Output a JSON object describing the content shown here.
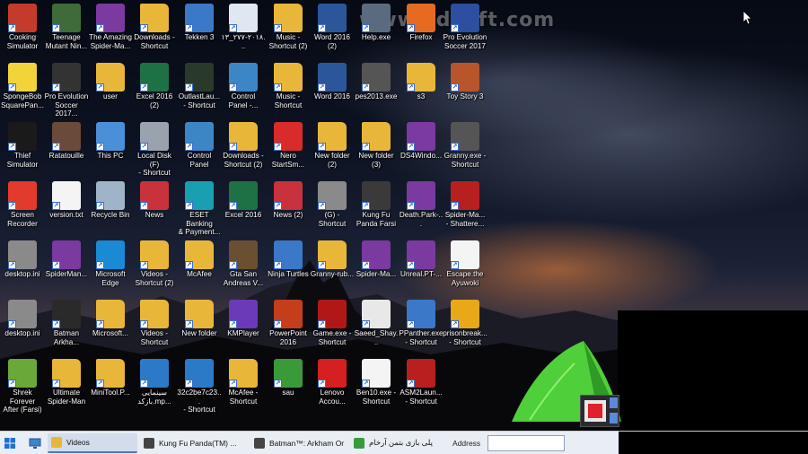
{
  "desktop": {
    "watermark": "www.zdsoft.com",
    "icons": [
      {
        "label": "Cooking\nSimulator",
        "icon": "cooking-game-icon",
        "color": "#c43b2b"
      },
      {
        "label": "Teenage\nMutant Nin...",
        "icon": "turtles-game-icon",
        "color": "#3f6b3a"
      },
      {
        "label": "The Amazing\nSpider-Ma...",
        "icon": "winrar-icon",
        "color": "#7a3aa0"
      },
      {
        "label": "Downloads -\nShortcut",
        "icon": "folder-download-icon",
        "color": "#e8b73a"
      },
      {
        "label": "Tekken 3",
        "icon": "window-icon",
        "color": "#3c78c8"
      },
      {
        "label": "٢٠١٨-٢٧٧_١٣...",
        "icon": "image-file-icon",
        "color": "#dfe7f2"
      },
      {
        "label": "Music -\nShortcut (2)",
        "icon": "folder-music-icon",
        "color": "#e8b73a"
      },
      {
        "label": "Word 2016\n(2)",
        "icon": "word-icon",
        "color": "#2b579a"
      },
      {
        "label": "Help.exe",
        "icon": "window-icon",
        "color": "#5a6b80"
      },
      {
        "label": "Firefox",
        "icon": "firefox-icon",
        "color": "#e66a1f"
      },
      {
        "label": "Pro Evolution\nSoccer 2017",
        "icon": "pes-icon",
        "color": "#2c4fa0"
      },
      {
        "label": "SpongeBob\nSquarePan...",
        "icon": "spongebob-icon",
        "color": "#f2d43a"
      },
      {
        "label": "Pro Evolution\nSoccer 2017...",
        "icon": "pes-icon",
        "color": "#333333"
      },
      {
        "label": "user",
        "icon": "folder-user-icon",
        "color": "#e8b73a"
      },
      {
        "label": "Excel 2016 (2)",
        "icon": "excel-icon",
        "color": "#1e7145"
      },
      {
        "label": "OutlastLau...\n- Shortcut",
        "icon": "outlast-icon",
        "color": "#2a3a2a"
      },
      {
        "label": "Control\nPanel -...",
        "icon": "control-panel-icon",
        "color": "#3d86c6"
      },
      {
        "label": "Music -\nShortcut",
        "icon": "folder-music-icon",
        "color": "#e8b73a"
      },
      {
        "label": "Word 2016",
        "icon": "word-icon",
        "color": "#2b579a"
      },
      {
        "label": "pes2013.exe",
        "icon": "pes-icon",
        "color": "#555555"
      },
      {
        "label": "s3",
        "icon": "folder-icon",
        "color": "#e8b73a"
      },
      {
        "label": "Toy Story 3",
        "icon": "toy-story-icon",
        "color": "#b9552b"
      },
      {
        "label": "Thief\nSimulator",
        "icon": "thief-icon",
        "color": "#1a1a1a"
      },
      {
        "label": "Ratatouille",
        "icon": "ratatouille-icon",
        "color": "#6a4a3a"
      },
      {
        "label": "This PC",
        "icon": "pc-icon",
        "color": "#4a90d8"
      },
      {
        "label": "Local Disk (F)\n- Shortcut",
        "icon": "disk-icon",
        "color": "#9aa3ad"
      },
      {
        "label": "Control\nPanel",
        "icon": "control-panel-icon",
        "color": "#3d86c6"
      },
      {
        "label": "Downloads -\nShortcut (2)",
        "icon": "folder-download-icon",
        "color": "#e8b73a"
      },
      {
        "label": "Nero\nStartSm...",
        "icon": "nero-icon",
        "color": "#d92b2b"
      },
      {
        "label": "New folder\n(2)",
        "icon": "folder-icon",
        "color": "#e8b73a"
      },
      {
        "label": "New folder\n(3)",
        "icon": "folder-icon",
        "color": "#e8b73a"
      },
      {
        "label": "DS4Windo...",
        "icon": "winrar-icon",
        "color": "#7a3aa0"
      },
      {
        "label": "Granny.exe -\nShortcut",
        "icon": "granny-icon",
        "color": "#555555"
      },
      {
        "label": "Screen\nRecorder",
        "icon": "record-icon",
        "color": "#e23b2b"
      },
      {
        "label": "version.txt",
        "icon": "text-file-icon",
        "color": "#f4f4f4"
      },
      {
        "label": "Recycle Bin",
        "icon": "recycle-bin-icon",
        "color": "#9fb4c8"
      },
      {
        "label": "News",
        "icon": "news-icon",
        "color": "#c8323c"
      },
      {
        "label": "ESET Banking\n& Payment...",
        "icon": "eset-icon",
        "color": "#1a9fb0"
      },
      {
        "label": "Excel 2016",
        "icon": "excel-icon",
        "color": "#1e7145"
      },
      {
        "label": "News (2)",
        "icon": "news-icon",
        "color": "#c8323c"
      },
      {
        "label": "(G) -\nShortcut",
        "icon": "dvd-drive-icon",
        "color": "#8a8a8a"
      },
      {
        "label": "Kung Fu\nPanda Farsi",
        "icon": "panda-icon",
        "color": "#3a3a3a"
      },
      {
        "label": "Death.Park-...",
        "icon": "winrar-icon",
        "color": "#7a3aa0"
      },
      {
        "label": "Spider-Ma...\n- Shattere...",
        "icon": "spiderman-icon",
        "color": "#b82020"
      },
      {
        "label": "desktop.ini",
        "icon": "settings-file-icon",
        "color": "#8a8a8a"
      },
      {
        "label": "SpiderMan...",
        "icon": "winrar-icon",
        "color": "#7a3aa0"
      },
      {
        "label": "Microsoft\nEdge",
        "icon": "edge-icon",
        "color": "#1a8ad4"
      },
      {
        "label": "Videos -\nShortcut (2)",
        "icon": "folder-video-icon",
        "color": "#e8b73a"
      },
      {
        "label": "McAfee",
        "icon": "folder-icon",
        "color": "#e8b73a"
      },
      {
        "label": "Gta San\nAndreas V...",
        "icon": "gta-icon",
        "color": "#6a5030"
      },
      {
        "label": "Ninja Turtles",
        "icon": "window-icon",
        "color": "#3c78c8"
      },
      {
        "label": "Granny-rub...",
        "icon": "folder-icon",
        "color": "#e8b73a"
      },
      {
        "label": "Spider-Ma...",
        "icon": "winrar-icon",
        "color": "#7a3aa0"
      },
      {
        "label": "Unreal.PT-...",
        "icon": "winrar-icon",
        "color": "#7a3aa0"
      },
      {
        "label": "Escape.the\nAyuwoki",
        "icon": "blank-file-icon",
        "color": "#f4f4f4"
      },
      {
        "label": "desktop.ini",
        "icon": "settings-file-icon",
        "color": "#8a8a8a"
      },
      {
        "label": "Batman\nArkha...",
        "icon": "batman-icon",
        "color": "#2a2a2a"
      },
      {
        "label": "Microsoft...",
        "icon": "folder-icon",
        "color": "#e8b73a"
      },
      {
        "label": "Videos -\nShortcut",
        "icon": "folder-video-icon",
        "color": "#e8b73a"
      },
      {
        "label": "New folder",
        "icon": "folder-icon",
        "color": "#e8b73a"
      },
      {
        "label": "KMPlayer",
        "icon": "kmplayer-icon",
        "color": "#6a3ab8"
      },
      {
        "label": "PowerPoint\n2016",
        "icon": "powerpoint-icon",
        "color": "#c43e1c"
      },
      {
        "label": "Game.exe -\nShortcut",
        "icon": "spider-emblem-icon",
        "color": "#b01818"
      },
      {
        "label": "Saeed_Shay...",
        "icon": "media-file-icon",
        "color": "#e8e8e8"
      },
      {
        "label": "PPanther.exe\n- Shortcut",
        "icon": "window-icon",
        "color": "#3c78c8"
      },
      {
        "label": "prisonbreak...\n- Shortcut",
        "icon": "prisonbreak-icon",
        "color": "#e8a818"
      },
      {
        "label": "Shrek Forever\nAfter (Farsi)",
        "icon": "shrek-icon",
        "color": "#6aa83a"
      },
      {
        "label": "Ultimate\nSpider-Man",
        "icon": "folder-icon",
        "color": "#e8b73a"
      },
      {
        "label": "MiniTool.P...",
        "icon": "folder-icon",
        "color": "#e8b73a"
      },
      {
        "label": "سینمایی\nبازکد.mp...",
        "icon": "video-file-icon",
        "color": "#2a7ac8"
      },
      {
        "label": "32c2be7c23...\n- Shortcut",
        "icon": "video-file-icon",
        "color": "#2a7ac8"
      },
      {
        "label": "McAfee -\nShortcut",
        "icon": "folder-icon",
        "color": "#e8b73a"
      },
      {
        "label": "sau",
        "icon": "chrome-icon",
        "color": "#3a9a3a"
      },
      {
        "label": "Lenovo\nAccou...",
        "icon": "lenovo-icon",
        "color": "#d42020"
      },
      {
        "label": "Ben10.exe -\nShortcut",
        "icon": "blank-file-icon",
        "color": "#f4f4f4"
      },
      {
        "label": "ASM2Laun...\n- Shortcut",
        "icon": "spiderman-icon",
        "color": "#b82020"
      }
    ]
  },
  "taskbar": {
    "items": [
      {
        "label": "Videos",
        "icon": "explorer-icon",
        "color": "#e8b73a",
        "active": true
      },
      {
        "label": "Kung Fu Panda(TM) ...",
        "icon": "game-icon",
        "color": "#444444",
        "active": false
      },
      {
        "label": "Batman™: Arkham Or...",
        "icon": "game-icon",
        "color": "#444444",
        "active": false
      },
      {
        "label": "گیم پلی بازی بتمن آرخام...",
        "icon": "chrome-icon",
        "color": "#3a9a3a",
        "active": false
      }
    ],
    "address_label": "Address",
    "address_value": ""
  }
}
